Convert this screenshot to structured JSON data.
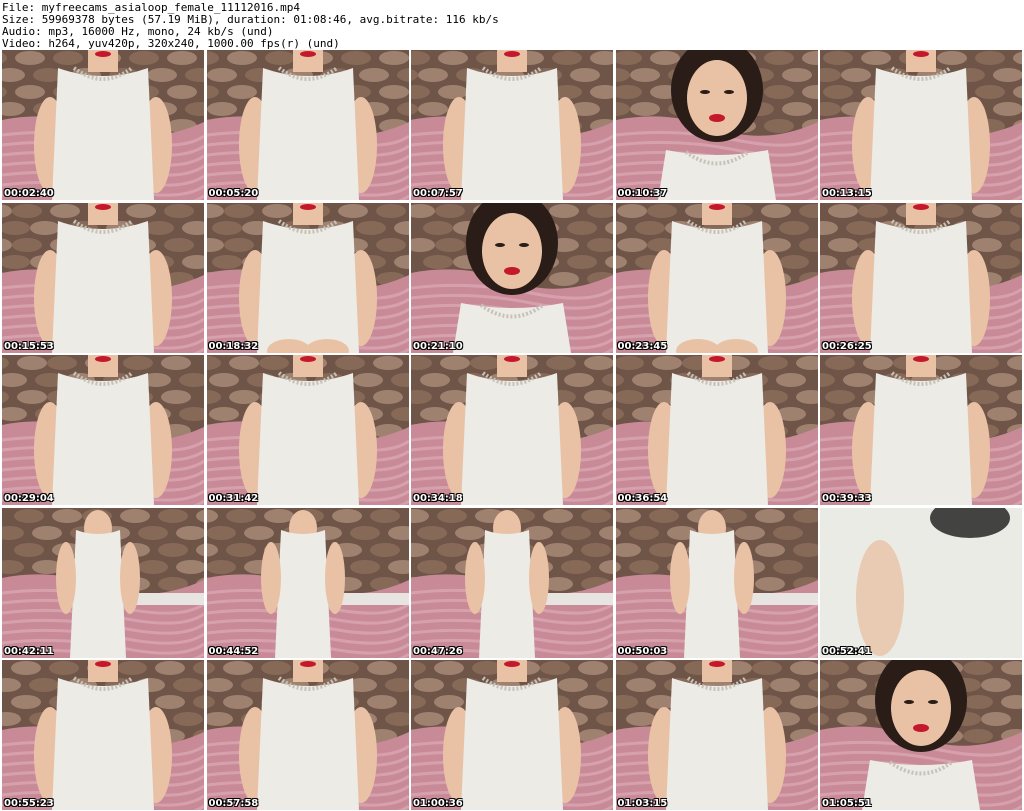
{
  "header": {
    "file_line": "File: myfreecams_asialoop_female_11112016.mp4",
    "size_line": "Size: 59969378 bytes (57.19 MiB), duration: 01:08:46, avg.bitrate: 116 kb/s",
    "audio_line": "Audio: mp3, 16000 Hz, mono, 24 kb/s (und)",
    "video_line": "Video: h264, yuv420p, 320x240, 1000.00 fps(r) (und)"
  },
  "thumbnails": [
    {
      "time": "00:02:40",
      "scene": "torso"
    },
    {
      "time": "00:05:20",
      "scene": "torso"
    },
    {
      "time": "00:07:57",
      "scene": "torso"
    },
    {
      "time": "00:10:37",
      "scene": "face"
    },
    {
      "time": "00:13:15",
      "scene": "torso"
    },
    {
      "time": "00:15:53",
      "scene": "torso"
    },
    {
      "time": "00:18:32",
      "scene": "seated"
    },
    {
      "time": "00:21:10",
      "scene": "face"
    },
    {
      "time": "00:23:45",
      "scene": "seated"
    },
    {
      "time": "00:26:25",
      "scene": "torso"
    },
    {
      "time": "00:29:04",
      "scene": "torso"
    },
    {
      "time": "00:31:42",
      "scene": "torso"
    },
    {
      "time": "00:34:18",
      "scene": "torso"
    },
    {
      "time": "00:36:54",
      "scene": "torso"
    },
    {
      "time": "00:39:33",
      "scene": "torso"
    },
    {
      "time": "00:42:11",
      "scene": "standing"
    },
    {
      "time": "00:44:52",
      "scene": "standing"
    },
    {
      "time": "00:47:26",
      "scene": "standing"
    },
    {
      "time": "00:50:03",
      "scene": "standing"
    },
    {
      "time": "00:52:41",
      "scene": "closeup"
    },
    {
      "time": "00:55:23",
      "scene": "torso"
    },
    {
      "time": "00:57:58",
      "scene": "torso"
    },
    {
      "time": "01:00:36",
      "scene": "torso"
    },
    {
      "time": "01:03:15",
      "scene": "torso"
    },
    {
      "time": "01:05:51",
      "scene": "face"
    }
  ],
  "colors": {
    "background": "#ffffff",
    "header_text": "#000000",
    "timestamp_text": "#ffffff",
    "blanket": "#c98a98",
    "blanket_light": "#dfb0bb",
    "wall_stone": "#6f5448",
    "wall_stone_light": "#a88a78",
    "dress": "#ecebe6",
    "skin": "#e9c2a6",
    "hair": "#2a1c16",
    "lips": "#c4182c"
  }
}
